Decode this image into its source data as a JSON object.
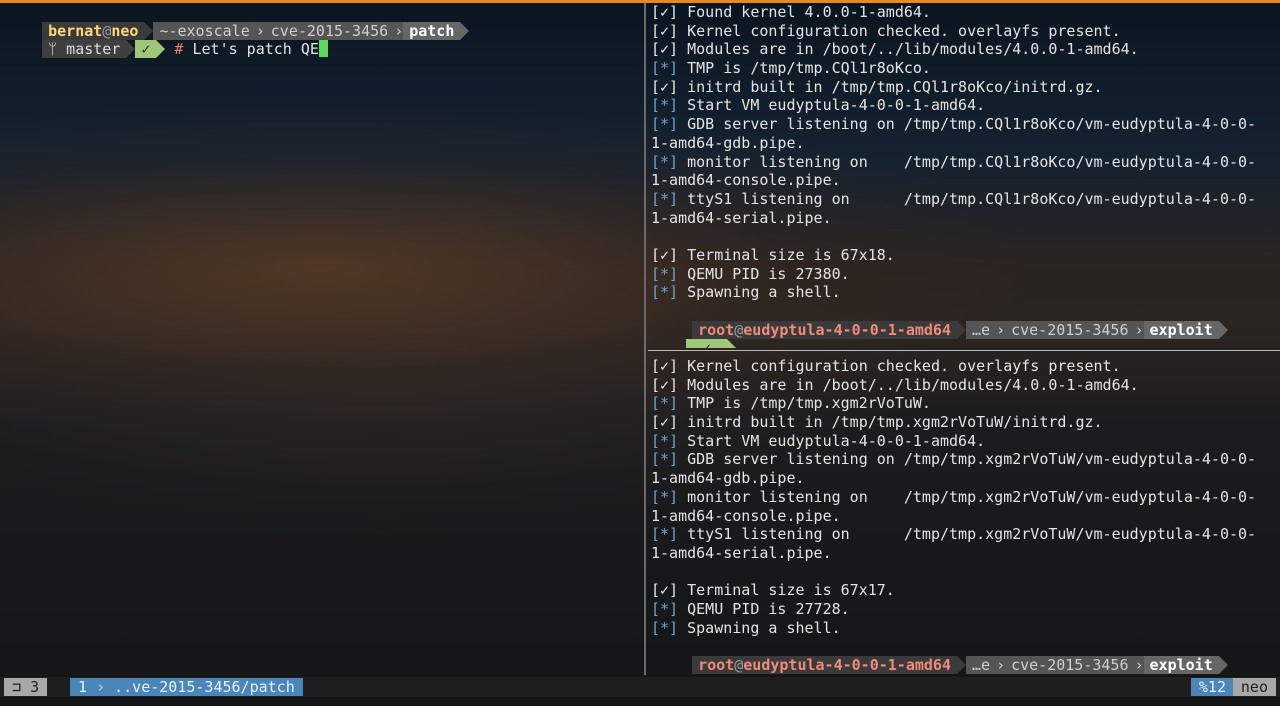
{
  "left_pane": {
    "user": "bernat",
    "at": "@",
    "host": "neo",
    "path_segments": [
      "~-exoscale",
      "cve-2015-3456"
    ],
    "path_last": "patch",
    "branch_icon": "branch-icon",
    "branch": "master",
    "status_mark": "✓",
    "hash": "#",
    "typed_command": "Let's patch QE"
  },
  "right_top": {
    "lines": [
      {
        "mark": "[✓]",
        "text": " Found kernel 4.0.0-1-amd64."
      },
      {
        "mark": "[✓]",
        "text": " Kernel configuration checked. overlayfs present."
      },
      {
        "mark": "[✓]",
        "text": " Modules are in /boot/../lib/modules/4.0.0-1-amd64."
      },
      {
        "mark": "[*]",
        "text": " TMP is /tmp/tmp.CQl1r8oKco."
      },
      {
        "mark": "[✓]",
        "text": " initrd built in /tmp/tmp.CQl1r8oKco/initrd.gz."
      },
      {
        "mark": "[*]",
        "text": " Start VM eudyptula-4-0-0-1-amd64."
      },
      {
        "mark": "[*]",
        "text": " GDB server listening on /tmp/tmp.CQl1r8oKco/vm-eudyptula-4-0-0-"
      },
      {
        "mark": "",
        "text": "1-amd64-gdb.pipe."
      },
      {
        "mark": "[*]",
        "text": " monitor listening on    /tmp/tmp.CQl1r8oKco/vm-eudyptula-4-0-0-"
      },
      {
        "mark": "",
        "text": "1-amd64-console.pipe."
      },
      {
        "mark": "[*]",
        "text": " ttyS1 listening on      /tmp/tmp.CQl1r8oKco/vm-eudyptula-4-0-0-"
      },
      {
        "mark": "",
        "text": "1-amd64-serial.pipe."
      },
      {
        "mark": "",
        "text": ""
      },
      {
        "mark": "[✓]",
        "text": " Terminal size is 67x18."
      },
      {
        "mark": "[*]",
        "text": " QEMU PID is 27380."
      },
      {
        "mark": "[*]",
        "text": " Spawning a shell."
      }
    ],
    "prompt_user": "root",
    "prompt_at": "@",
    "prompt_host": "eudyptula-4-0-0-1-amd64",
    "prompt_path1": "…e",
    "prompt_path2": "cve-2015-3456",
    "prompt_last": "exploit",
    "prompt_ok": "✓"
  },
  "right_bottom": {
    "lines": [
      {
        "mark": "[✓]",
        "text": " Kernel configuration checked. overlayfs present."
      },
      {
        "mark": "[✓]",
        "text": " Modules are in /boot/../lib/modules/4.0.0-1-amd64."
      },
      {
        "mark": "[*]",
        "text": " TMP is /tmp/tmp.xgm2rVoTuW."
      },
      {
        "mark": "[✓]",
        "text": " initrd built in /tmp/tmp.xgm2rVoTuW/initrd.gz."
      },
      {
        "mark": "[*]",
        "text": " Start VM eudyptula-4-0-0-1-amd64."
      },
      {
        "mark": "[*]",
        "text": " GDB server listening on /tmp/tmp.xgm2rVoTuW/vm-eudyptula-4-0-0-"
      },
      {
        "mark": "",
        "text": "1-amd64-gdb.pipe."
      },
      {
        "mark": "[*]",
        "text": " monitor listening on    /tmp/tmp.xgm2rVoTuW/vm-eudyptula-4-0-0-"
      },
      {
        "mark": "",
        "text": "1-amd64-console.pipe."
      },
      {
        "mark": "[*]",
        "text": " ttyS1 listening on      /tmp/tmp.xgm2rVoTuW/vm-eudyptula-4-0-0-"
      },
      {
        "mark": "",
        "text": "1-amd64-serial.pipe."
      },
      {
        "mark": "",
        "text": ""
      },
      {
        "mark": "[✓]",
        "text": " Terminal size is 67x17."
      },
      {
        "mark": "[*]",
        "text": " QEMU PID is 27728."
      },
      {
        "mark": "[*]",
        "text": " Spawning a shell."
      }
    ],
    "prompt_user": "root",
    "prompt_at": "@",
    "prompt_host": "eudyptula-4-0-0-1-amd64",
    "prompt_path1": "…e",
    "prompt_path2": "cve-2015-3456",
    "prompt_last": "exploit",
    "prompt_ok": "✓"
  },
  "status_bar": {
    "window_icon": "window-icon",
    "window_index": "3",
    "pane_index": "1",
    "pane_path": "..ve-2015-3456/patch",
    "right_pane_count": "%12",
    "right_host": "neo"
  },
  "colors": {
    "accent_top": "#e8891e",
    "tmux_blue": "#4a86b8",
    "ok_green": "#9ec77a",
    "info_blue": "#6aa5cf",
    "cursor_green": "#5fd75f"
  }
}
